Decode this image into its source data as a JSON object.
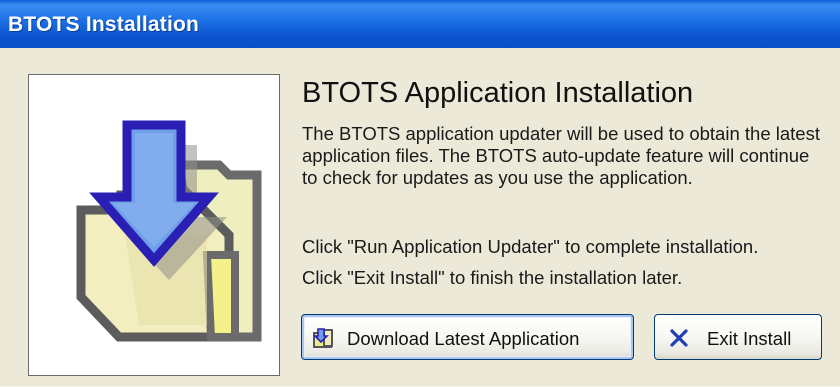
{
  "window": {
    "title": "BTOTS Installation"
  },
  "heading": "BTOTS Application Installation",
  "description": "The BTOTS application updater will be used to obtain the latest application files. The BTOTS auto-update feature will continue to check for updates as you use the application.",
  "instruction_run": "Click \"Run Application Updater\" to complete installation.",
  "instruction_exit": "Click \"Exit Install\" to finish the installation later.",
  "buttons": {
    "download_label": "Download Latest Application",
    "download_icon": "download-folder-icon",
    "exit_label": "Exit Install",
    "exit_icon": "x-icon"
  },
  "image": {
    "icon": "download-arrow-folder-icon"
  },
  "colors": {
    "titlebar": "#0b55cf",
    "background": "#ece9d8",
    "arrow_fill": "#6f9fe8",
    "arrow_border": "#2a1fb4",
    "folder_fill": "#f5f0b8",
    "exit_x": "#1f3fb5"
  }
}
